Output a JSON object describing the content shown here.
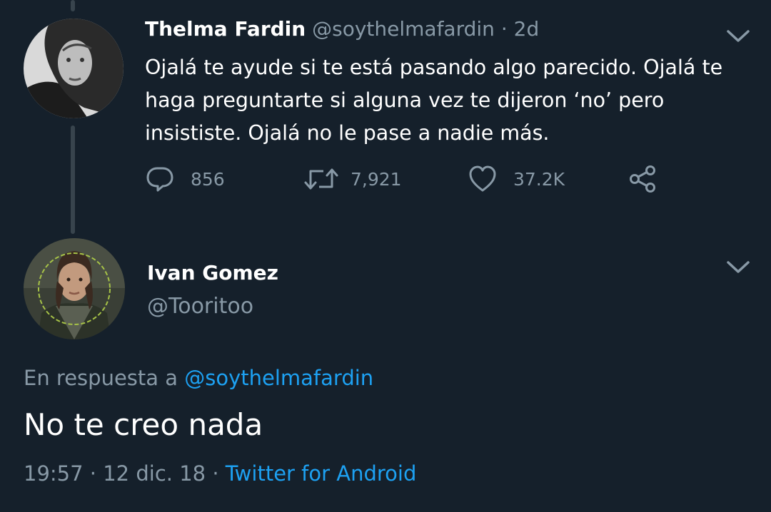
{
  "tweet": {
    "author_name": "Thelma Fardin",
    "author_handle": "@soythelmafardin",
    "separator": "·",
    "age": "2d",
    "text": "Ojalá te ayude si te está pasando algo parecido. Ojalá te haga preguntarte si alguna vez te dijeron ‘no’ pero insististe. Ojalá no le pase a nadie más.",
    "actions": {
      "replies": "856",
      "retweets": "7,921",
      "likes": "37.2K"
    }
  },
  "reply": {
    "author_name": "Ivan Gomez",
    "author_handle": "@Tooritoo",
    "in_reply_to_label": "En respuesta a",
    "in_reply_to_handle": "@soythelmafardin",
    "text": "No te creo nada",
    "time": "19:57",
    "date": "12 dic. 18",
    "separator": "·",
    "source": "Twitter for Android"
  },
  "colors": {
    "background": "#15202b",
    "primary_text": "#ffffff",
    "secondary_text": "#8899a6",
    "accent": "#1da1f2",
    "thread_line": "#38444d"
  },
  "icons": {
    "reply": "reply-icon",
    "retweet": "retweet-icon",
    "like": "heart-icon",
    "share": "share-icon",
    "more": "chevron-down-icon"
  }
}
